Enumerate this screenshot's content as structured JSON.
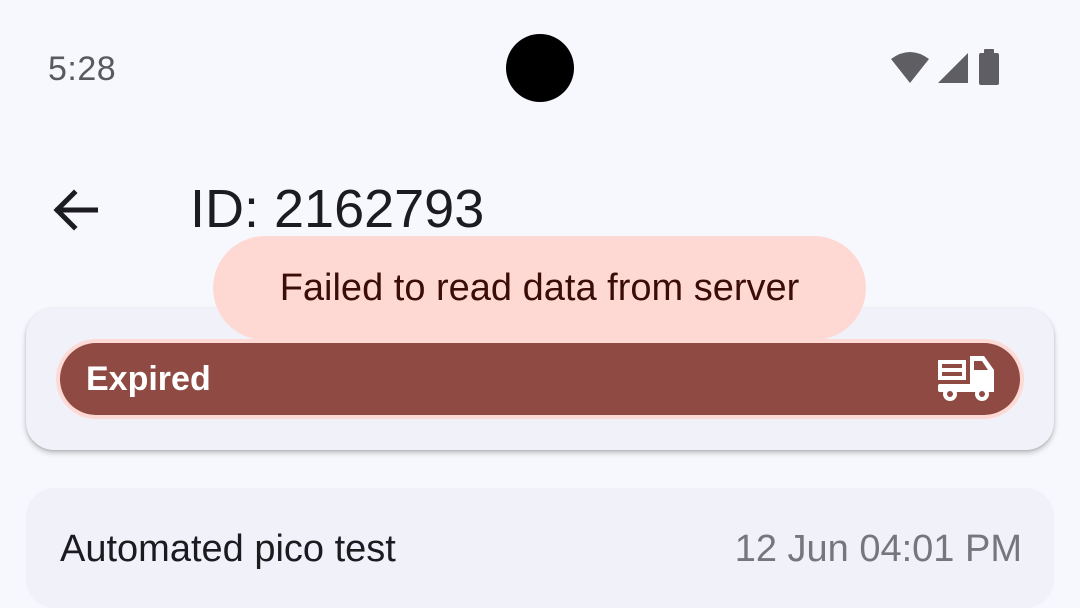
{
  "status_bar": {
    "time": "5:28",
    "icons": [
      "wifi-icon",
      "signal-icon",
      "battery-icon"
    ]
  },
  "app_bar": {
    "title": "ID: 2162793",
    "back_icon": "arrow-back-icon"
  },
  "toast": {
    "message": "Failed to read data from server"
  },
  "status_card": {
    "label": "Expired",
    "icon": "fire-truck-icon",
    "colors": {
      "pill": "#8f4a43",
      "outline": "#fddad5",
      "card": "#f1f2f9"
    }
  },
  "entry": {
    "name": "Automated pico test",
    "date": "12 Jun 04:01 PM"
  },
  "colors": {
    "background": "#f7f8fd",
    "toast": "#fed9d4"
  }
}
